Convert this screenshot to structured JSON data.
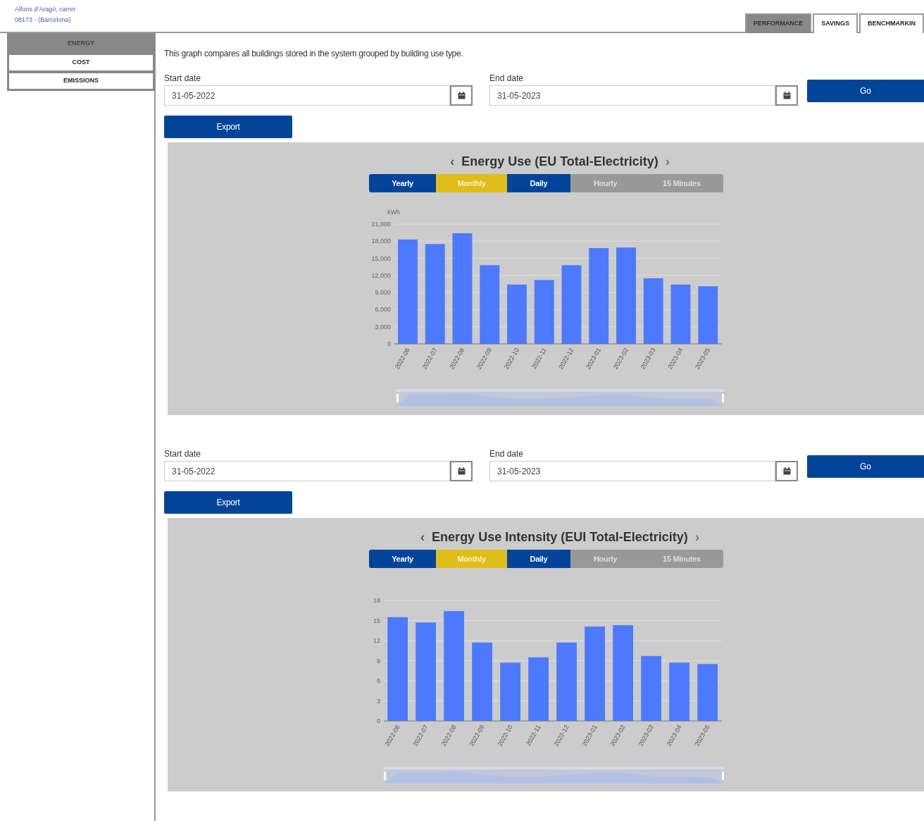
{
  "address": {
    "line_1": "Alfons d'Aragó, carrer",
    "line_2": "08173 - (Barcelona)"
  },
  "top_tabs": [
    {
      "label": "PERFORMANCE",
      "selected": true
    },
    {
      "label": "SAVINGS",
      "selected": false
    },
    {
      "label": "BENCHMARKIN",
      "selected": false
    }
  ],
  "sidebar": {
    "items": [
      {
        "label": "ENERGY",
        "selected": true
      },
      {
        "label": "COST",
        "selected": false
      },
      {
        "label": "EMISSIONS",
        "selected": false
      }
    ]
  },
  "description": "This graph compares all buildings stored in the system grouped by building use type.",
  "sections": [
    {
      "start_date": {
        "label": "Start date",
        "value": "31-05-2022"
      },
      "end_date": {
        "label": "End date",
        "value": "31-05-2023"
      },
      "go_button": "Go",
      "export_button": "Export",
      "chart": {
        "title": "Energy Use (EU Total-Electricity)",
        "prev": "‹",
        "next": "›",
        "periods": [
          {
            "label": "Yearly",
            "selected": false,
            "disabled": false
          },
          {
            "label": "Monthly",
            "selected": true,
            "disabled": false
          },
          {
            "label": "Daily",
            "selected": false,
            "disabled": false
          },
          {
            "label": "Hourly",
            "selected": false,
            "disabled": true
          },
          {
            "label": "15 Minutes",
            "selected": false,
            "disabled": true
          }
        ],
        "chart_data": {
          "type": "bar",
          "ylabel": "kWh",
          "categories": [
            "2022-06",
            "2022-07",
            "2022-08",
            "2022-09",
            "2022-10",
            "2022-11",
            "2022-12",
            "2023-01",
            "2023-02",
            "2023-03",
            "2023-04",
            "2023-05"
          ],
          "grid": true,
          "series": [
            {
              "color": "#4d79ff",
              "values": [
                18300,
                17500,
                19400,
                13800,
                10400,
                11200,
                13800,
                16800,
                16900,
                11500,
                10400,
                10100
              ]
            }
          ],
          "ylim": [
            0,
            21000
          ],
          "yticks": [
            {
              "value": 0,
              "label": "0"
            },
            {
              "value": 3000,
              "label": "3,000"
            },
            {
              "value": 6000,
              "label": "6,000"
            },
            {
              "value": 9000,
              "label": "9,000"
            },
            {
              "value": 12000,
              "label": "12,000"
            },
            {
              "value": 15000,
              "label": "15,000"
            },
            {
              "value": 18000,
              "label": "18,000"
            },
            {
              "value": 21000,
              "label": "21,000"
            }
          ]
        }
      }
    },
    {
      "start_date": {
        "label": "Start date",
        "value": "31-05-2022"
      },
      "end_date": {
        "label": "End date",
        "value": "31-05-2023"
      },
      "go_button": "Go",
      "export_button": "Export",
      "chart": {
        "title": "Energy Use Intensity (EUI Total-Electricity)",
        "prev": "‹",
        "next": "›",
        "periods": [
          {
            "label": "Yearly",
            "selected": false,
            "disabled": false
          },
          {
            "label": "Monthly",
            "selected": true,
            "disabled": false
          },
          {
            "label": "Daily",
            "selected": false,
            "disabled": false
          },
          {
            "label": "Hourly",
            "selected": false,
            "disabled": true
          },
          {
            "label": "15 Minutes",
            "selected": false,
            "disabled": true
          }
        ],
        "chart_data": {
          "type": "bar",
          "categories": [
            "2022-06",
            "2022-07",
            "2022-08",
            "2022-09",
            "2022-10",
            "2022-11",
            "2022-12",
            "2023-01",
            "2023-02",
            "2023-03",
            "2023-04",
            "2023-05"
          ],
          "grid": true,
          "series": [
            {
              "color": "#4d79ff",
              "values": [
                15.5,
                14.7,
                16.4,
                11.7,
                8.7,
                9.5,
                11.7,
                14.1,
                14.3,
                9.7,
                8.7,
                8.5
              ]
            }
          ],
          "ylim": [
            0,
            18
          ],
          "yticks": [
            0,
            3,
            6,
            9,
            12,
            15,
            18
          ]
        }
      }
    }
  ]
}
